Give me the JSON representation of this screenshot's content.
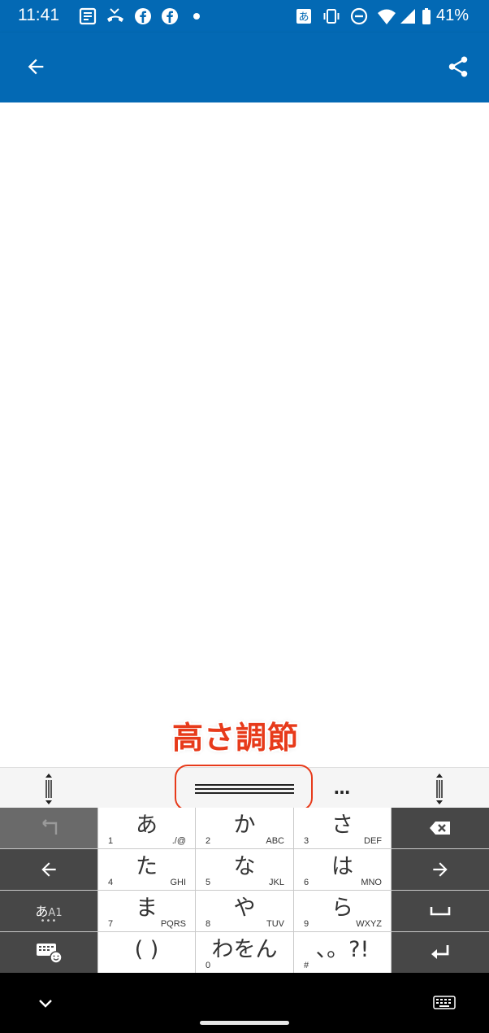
{
  "status_bar": {
    "time": "11:41",
    "battery_text": "41%",
    "ime_indicator": "あ",
    "left_icons": [
      "news-icon",
      "missed-call-icon",
      "facebook-icon",
      "facebook-icon",
      "dot-icon"
    ],
    "right_icons": [
      "ime-icon",
      "vibrate-icon",
      "do-not-disturb-icon",
      "wifi-icon",
      "signal-icon",
      "battery-icon"
    ]
  },
  "app_bar": {
    "color": "#0369b4",
    "back_icon": "arrow-back-icon",
    "share_icon": "share-icon"
  },
  "annotation": {
    "label": "高さ調節",
    "color": "#e73a1a"
  },
  "keyboard_toolbar": {
    "more_label": "…",
    "left_handle_icon": "resize-handle-icon",
    "right_handle_icon": "resize-handle-icon"
  },
  "keyboard": {
    "rows": [
      {
        "left": {
          "icon": "undo-icon"
        },
        "keys": [
          {
            "main": "あ",
            "num": "1",
            "sub": "./@"
          },
          {
            "main": "か",
            "num": "2",
            "sub": "ABC"
          },
          {
            "main": "さ",
            "num": "3",
            "sub": "DEF"
          }
        ],
        "right": {
          "icon": "backspace-icon"
        }
      },
      {
        "left": {
          "icon": "arrow-left-icon"
        },
        "keys": [
          {
            "main": "た",
            "num": "4",
            "sub": "GHI"
          },
          {
            "main": "な",
            "num": "5",
            "sub": "JKL"
          },
          {
            "main": "は",
            "num": "6",
            "sub": "MNO"
          }
        ],
        "right": {
          "icon": "arrow-right-icon"
        }
      },
      {
        "left": {
          "label_main": "あ",
          "label_sub": "A1",
          "dots": "•••"
        },
        "keys": [
          {
            "main": "ま",
            "num": "7",
            "sub": "PQRS"
          },
          {
            "main": "や",
            "num": "8",
            "sub": "TUV"
          },
          {
            "main": "ら",
            "num": "9",
            "sub": "WXYZ"
          }
        ],
        "right": {
          "icon": "space-icon"
        }
      },
      {
        "left": {
          "icon": "keyboard-emoji-icon"
        },
        "keys": [
          {
            "main": "( )",
            "num": "",
            "sub": ""
          },
          {
            "main": "わをん",
            "num": "0",
            "sub": ""
          },
          {
            "main": "、。?!",
            "num": "#",
            "sub": ""
          }
        ],
        "right": {
          "icon": "enter-icon"
        }
      }
    ]
  },
  "nav_bar": {
    "collapse_icon": "chevron-down-icon",
    "keyboard_icon": "keyboard-icon"
  }
}
